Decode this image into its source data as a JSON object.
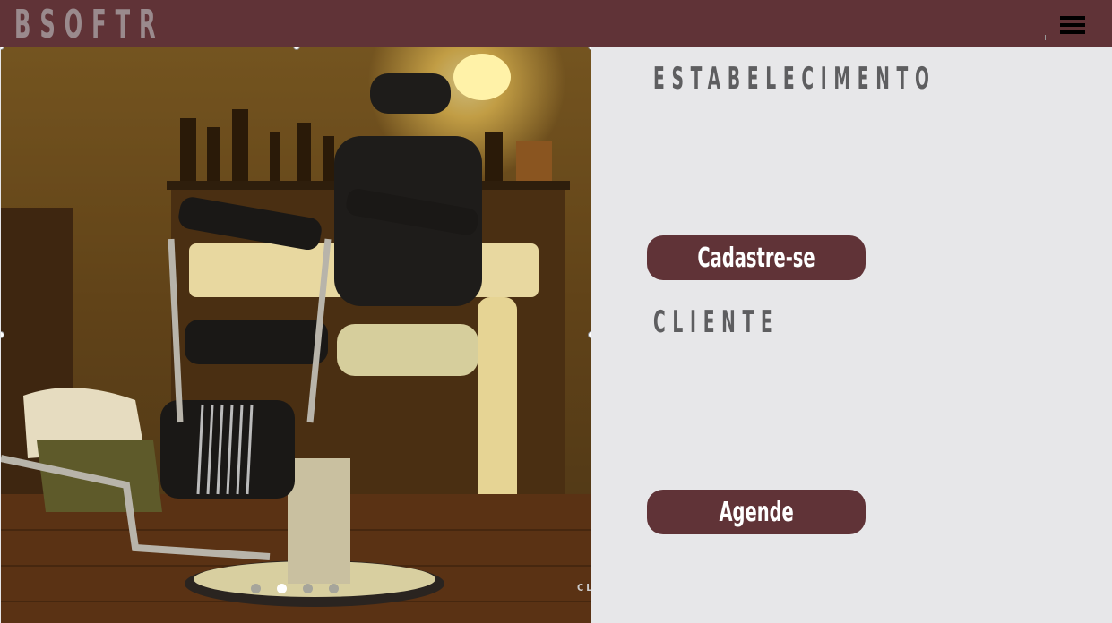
{
  "header": {
    "logo": "BSOFTR",
    "menu_icon": "hamburger-menu-icon",
    "background": "#603337"
  },
  "hero": {
    "image_icon": "barber-chair-photo",
    "carousel": {
      "slides": 4,
      "active": 2
    },
    "click_label": "CLICK"
  },
  "panel": {
    "establishment_heading": "ESTABELECIMENTO",
    "register_button": "Cadastre-se",
    "client_heading": "CLIENTE",
    "schedule_button": "Agende"
  },
  "colors": {
    "accent": "#603337",
    "panel_bg": "#e7e7e9",
    "heading": "#5e5e60"
  }
}
